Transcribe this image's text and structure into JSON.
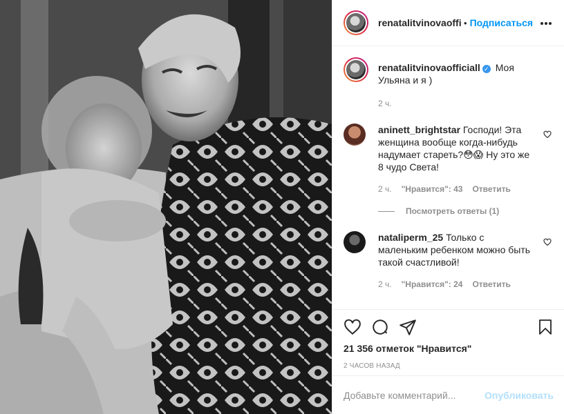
{
  "header": {
    "username": "renatalitvinovaofficiall",
    "dot": "•",
    "follow_label": "Подписаться"
  },
  "caption": {
    "username": "renatalitvinovaofficiall",
    "verified_icon": "✓",
    "text": "Моя Ульяна и я )",
    "time": "2 ч."
  },
  "comments": [
    {
      "username": "aninett_brightstar",
      "text": "Господи! Эта женщина вообще когда-нибудь надумает стареть?😳😱 Ну это же 8 чудо Света!",
      "time": "2 ч.",
      "likes": "\"Нравится\": 43",
      "reply_label": "Ответить",
      "view_replies": "Посмотреть ответы (1)"
    },
    {
      "username": "nataliperm_25",
      "text": "Только с маленьким ребенком можно быть такой счастливой!",
      "time": "2 ч.",
      "likes": "\"Нравится\": 24",
      "reply_label": "Ответить"
    }
  ],
  "stats": {
    "likes": "21 356 отметок \"Нравится\"",
    "posted": "2 часов назад"
  },
  "add_comment": {
    "placeholder": "Добавьте комментарий...",
    "publish_label": "Опубликовать"
  },
  "icons": {
    "like": "heart-icon",
    "comment": "comment-icon",
    "share": "share-icon",
    "save": "bookmark-icon",
    "more": "more-icon"
  },
  "colors": {
    "accent": "#0095f6",
    "publish_disabled": "#b2dffc",
    "muted": "#8e8e8e",
    "text": "#262626"
  }
}
